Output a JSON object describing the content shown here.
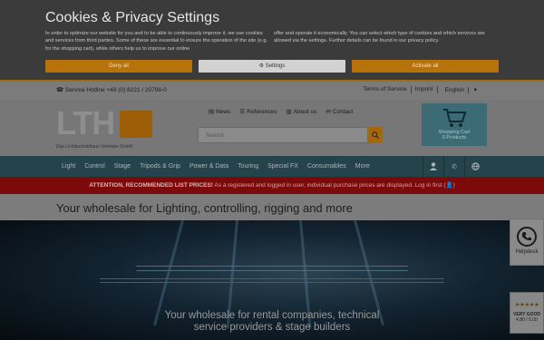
{
  "cookie": {
    "title": "Cookies & Privacy Settings",
    "text1": "In order to optimize our website for you and to be able to continuously improve it, we use cookies and services from third parties. Some of these are essential to ensure the operation of the site (e.g. for the shopping cart), while others help us to improve our online",
    "text2": "offer and operate it economically. You can select which type of cookies and which services are allowed via the settings. Further details can be found in our privacy policy.",
    "deny": "Deny all",
    "settings": "Settings",
    "accept": "Activate all"
  },
  "topbar": {
    "hotline": "Service Hotline +49 (0) 8221 / 20798-0",
    "links": [
      "Terms of Service",
      "Imprint",
      "English"
    ]
  },
  "logo": {
    "letters": "LTH",
    "sub": "Das Lichttechnikhaus Vertriebs GmbH"
  },
  "nav": [
    "News",
    "References",
    "About us",
    "Contact"
  ],
  "search": {
    "placeholder": "Search"
  },
  "cart": {
    "label": "Shopping Cart",
    "count": "0 Products"
  },
  "categories": [
    "Light",
    "Control",
    "Stage",
    "Tripods & Grip",
    "Power & Data",
    "Touring",
    "Special FX",
    "Consumables",
    "More"
  ],
  "attention": {
    "bold": "ATTENTION, RECOMMENDED LIST PRICES!",
    "rest": "As a registered and logged in user, individual purchase prices are displayed. Log in first ("
  },
  "strip_title": "Your wholesale for Lighting, controlling, rigging and more",
  "hero": {
    "line1": "Your wholesale for rental companies, technical",
    "line2": "service providers & stage builders"
  },
  "helpdesk": "Helpdesk",
  "rating": {
    "label": "VERY GOOD",
    "score": "4.80 / 5.00"
  },
  "colors": {
    "accent": "#b8720a",
    "category_bar": "#24434b",
    "attention": "#7d0a0a",
    "cart": "#3c6b76"
  }
}
